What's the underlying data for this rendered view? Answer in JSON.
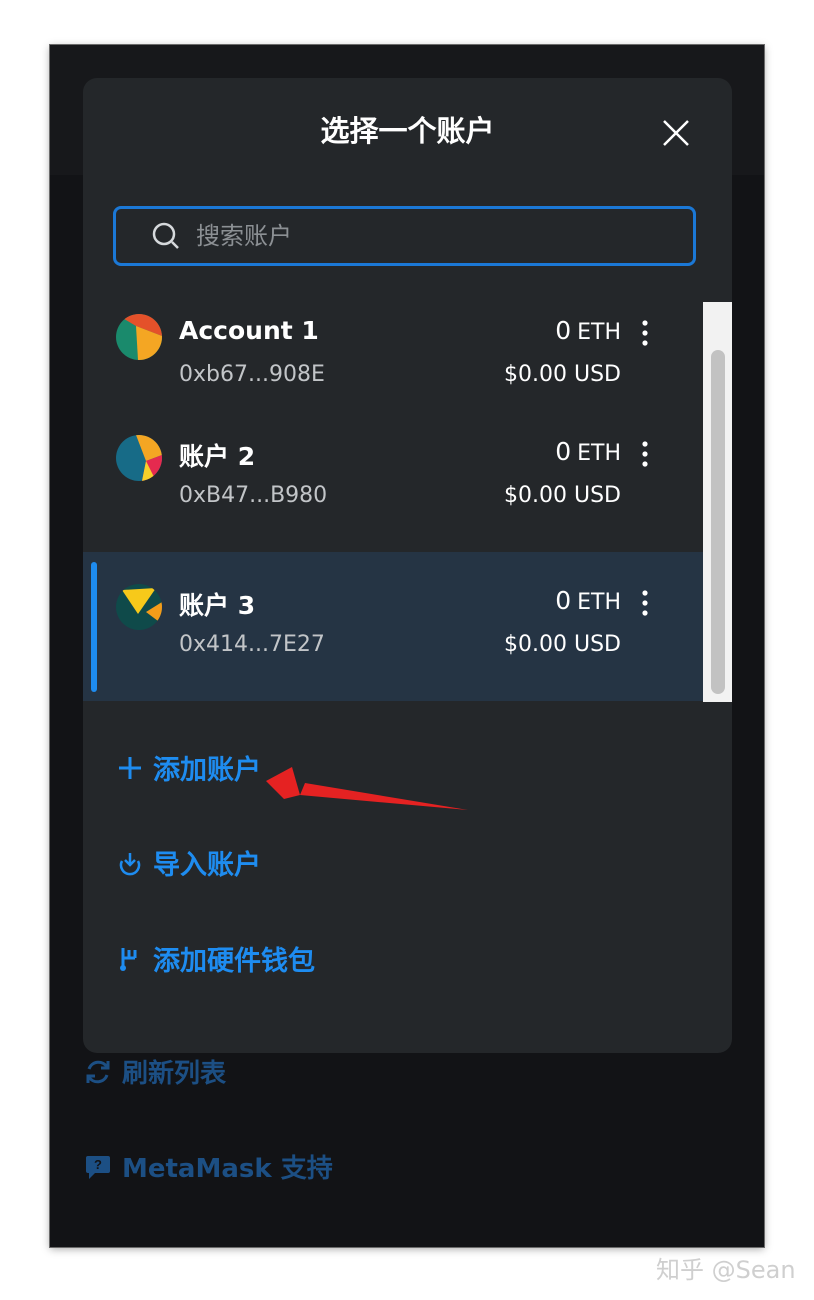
{
  "background_menu": {
    "refresh_label": "刷新列表",
    "support_label": "MetaMask 支持"
  },
  "modal": {
    "title": "选择一个账户",
    "search_placeholder": "搜索账户",
    "accounts": [
      {
        "name": "Account 1",
        "address": "0xb67...908E",
        "balance": "0",
        "unit": "ETH",
        "usd": "$0.00 USD",
        "selected": false
      },
      {
        "name": "账户 2",
        "address": "0xB47...B980",
        "balance": "0",
        "unit": "ETH",
        "usd": "$0.00 USD",
        "selected": false
      },
      {
        "name": "账户 3",
        "address": "0x414...7E27",
        "balance": "0",
        "unit": "ETH",
        "usd": "$0.00 USD",
        "selected": true
      }
    ],
    "actions": {
      "add_account": "添加账户",
      "import_account": "导入账户",
      "add_hardware_wallet": "添加硬件钱包"
    }
  },
  "watermark": "知乎 @Sean",
  "colors": {
    "accent": "#1e8cf0",
    "modal_bg": "#24272a",
    "selected_row": "#253444",
    "annotation_arrow": "#e52222"
  },
  "icons": [
    "close-icon",
    "search-icon",
    "kebab-menu-icon",
    "plus-icon",
    "import-icon",
    "hardware-wallet-icon",
    "refresh-icon",
    "chat-support-icon"
  ]
}
